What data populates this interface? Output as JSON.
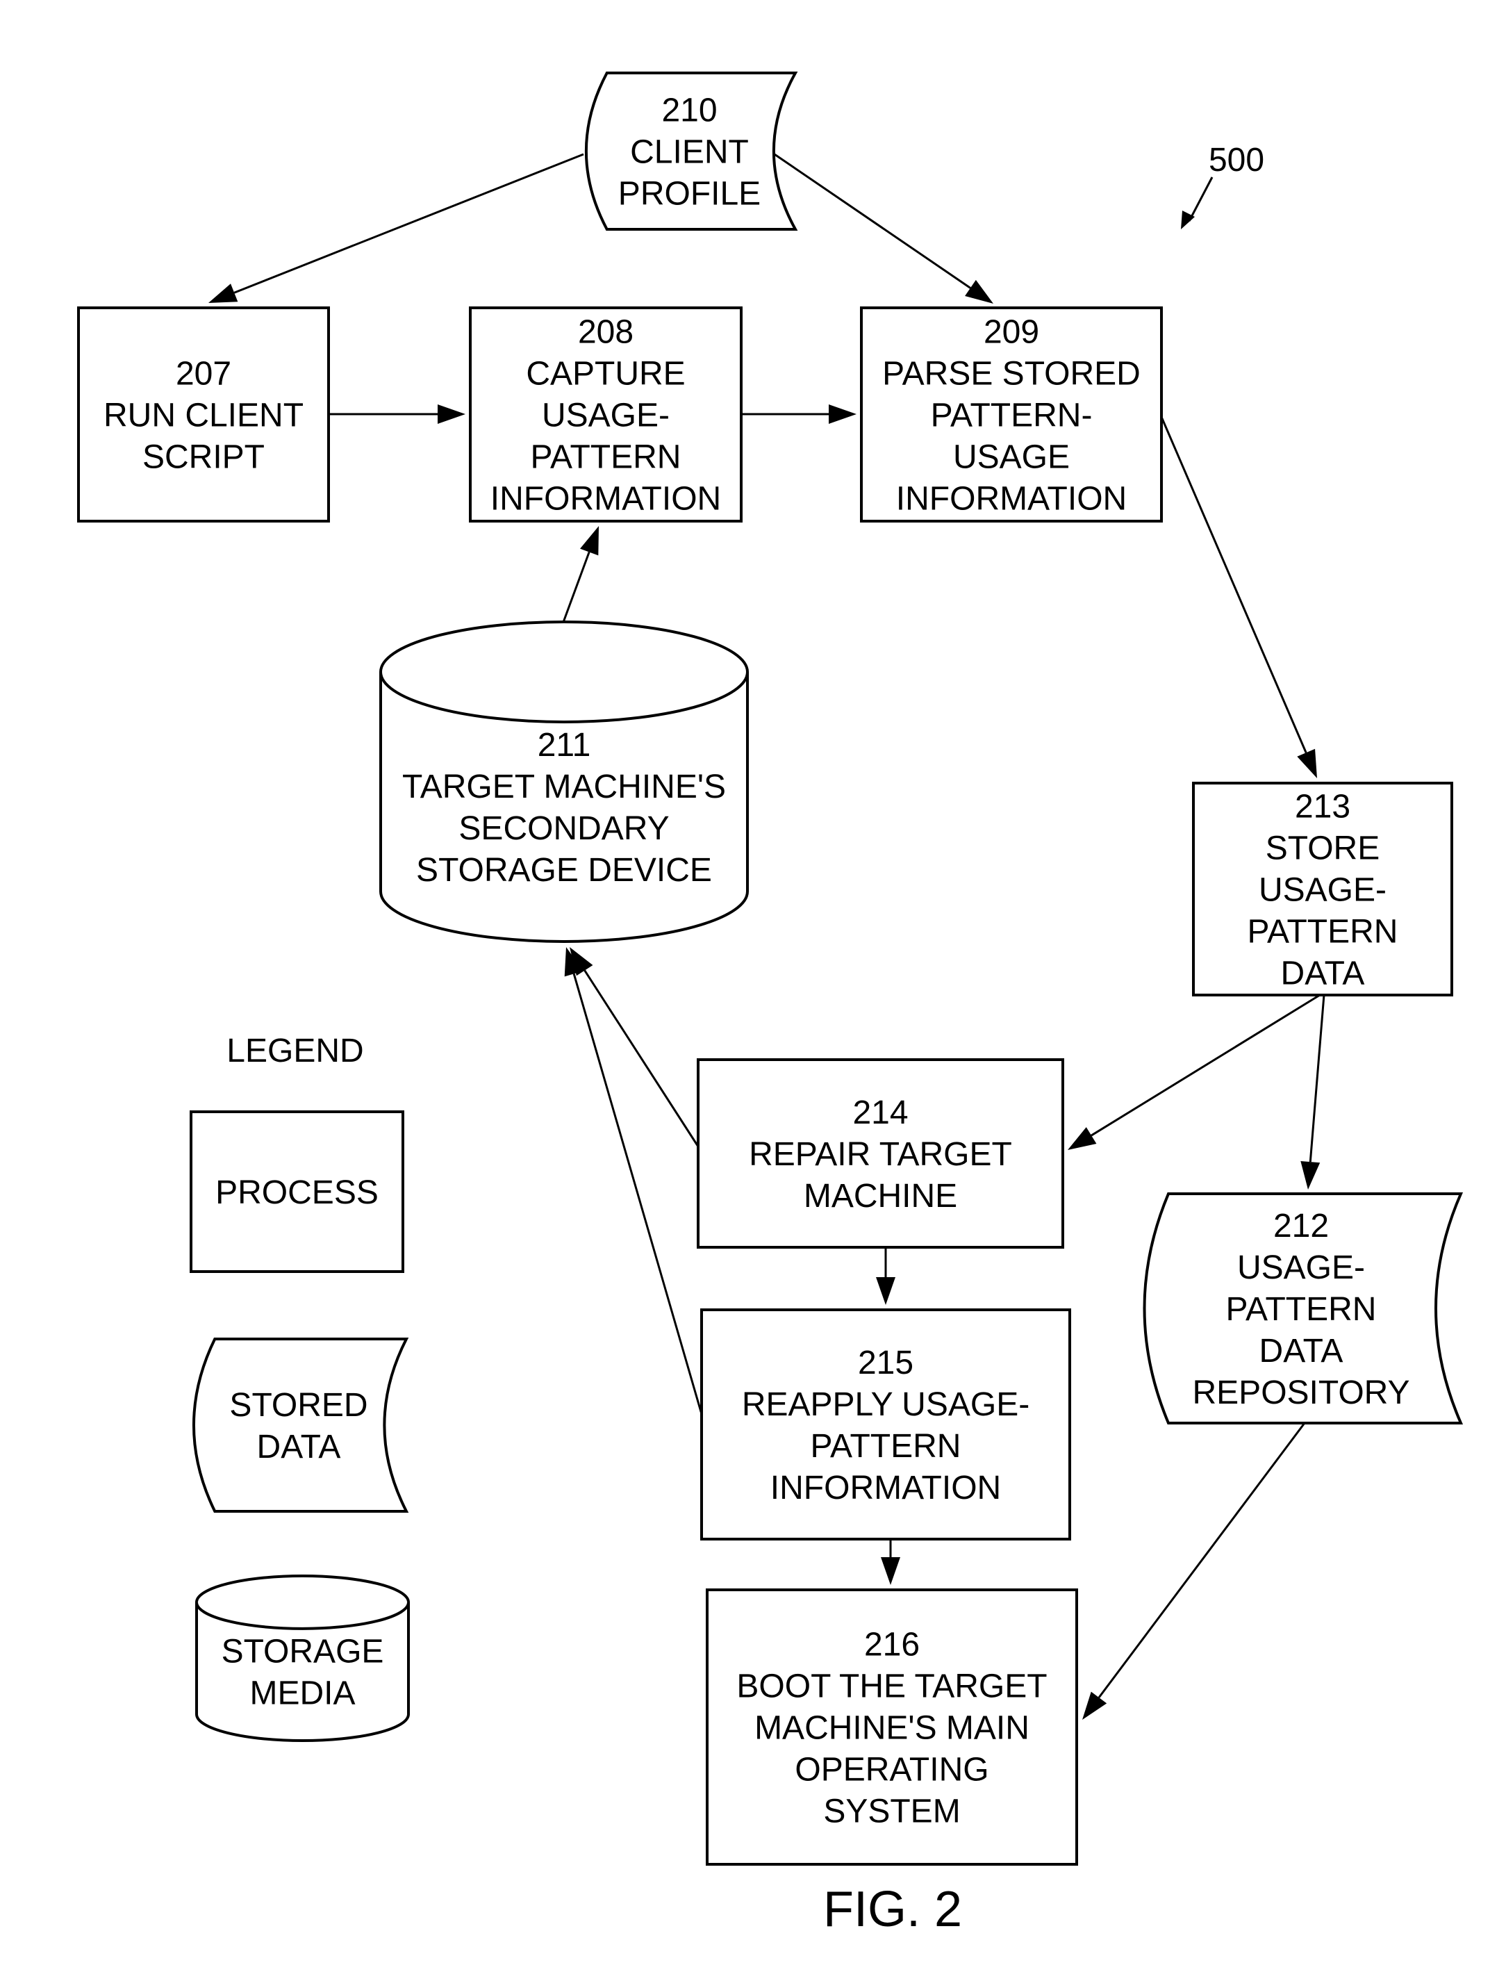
{
  "diagram": {
    "reference_number": "500",
    "figure_label": "FIG. 2",
    "nodes": [
      {
        "id": "210",
        "type": "stored-data",
        "lines": [
          "210",
          "CLIENT",
          "PROFILE"
        ]
      },
      {
        "id": "207",
        "type": "process",
        "lines": [
          "207",
          "RUN CLIENT",
          "SCRIPT"
        ]
      },
      {
        "id": "208",
        "type": "process",
        "lines": [
          "208",
          "CAPTURE",
          "USAGE-",
          "PATTERN",
          "INFORMATION"
        ]
      },
      {
        "id": "209",
        "type": "process",
        "lines": [
          "209",
          "PARSE STORED",
          "PATTERN-",
          "USAGE",
          "INFORMATION"
        ]
      },
      {
        "id": "211",
        "type": "storage-media",
        "lines": [
          "211",
          "TARGET MACHINE'S",
          "SECONDARY",
          "STORAGE DEVICE"
        ]
      },
      {
        "id": "213",
        "type": "process",
        "lines": [
          "213",
          "STORE",
          "USAGE-",
          "PATTERN",
          "DATA"
        ]
      },
      {
        "id": "214",
        "type": "process",
        "lines": [
          "214",
          "REPAIR TARGET",
          "MACHINE"
        ]
      },
      {
        "id": "215",
        "type": "process",
        "lines": [
          "215",
          "REAPPLY USAGE-",
          "PATTERN",
          "INFORMATION"
        ]
      },
      {
        "id": "212",
        "type": "stored-data",
        "lines": [
          "212",
          "USAGE-",
          "PATTERN",
          "DATA",
          "REPOSITORY"
        ]
      },
      {
        "id": "216",
        "type": "process",
        "lines": [
          "216",
          "BOOT THE TARGET",
          "MACHINE'S MAIN",
          "OPERATING",
          "SYSTEM"
        ]
      }
    ],
    "edges": [
      {
        "from": "210",
        "to": "207"
      },
      {
        "from": "210",
        "to": "209"
      },
      {
        "from": "207",
        "to": "208"
      },
      {
        "from": "208",
        "to": "209"
      },
      {
        "from": "211",
        "to": "208"
      },
      {
        "from": "209",
        "to": "213"
      },
      {
        "from": "213",
        "to": "214"
      },
      {
        "from": "213",
        "to": "212"
      },
      {
        "from": "214",
        "to": "211"
      },
      {
        "from": "215",
        "to": "211"
      },
      {
        "from": "214",
        "to": "215"
      },
      {
        "from": "215",
        "to": "216"
      },
      {
        "from": "212",
        "to": "216"
      }
    ],
    "legend": {
      "title": "LEGEND",
      "items": [
        {
          "type": "process",
          "lines": [
            "PROCESS"
          ]
        },
        {
          "type": "stored-data",
          "lines": [
            "STORED",
            "DATA"
          ]
        },
        {
          "type": "storage-media",
          "lines": [
            "STORAGE",
            "MEDIA"
          ]
        }
      ]
    }
  }
}
